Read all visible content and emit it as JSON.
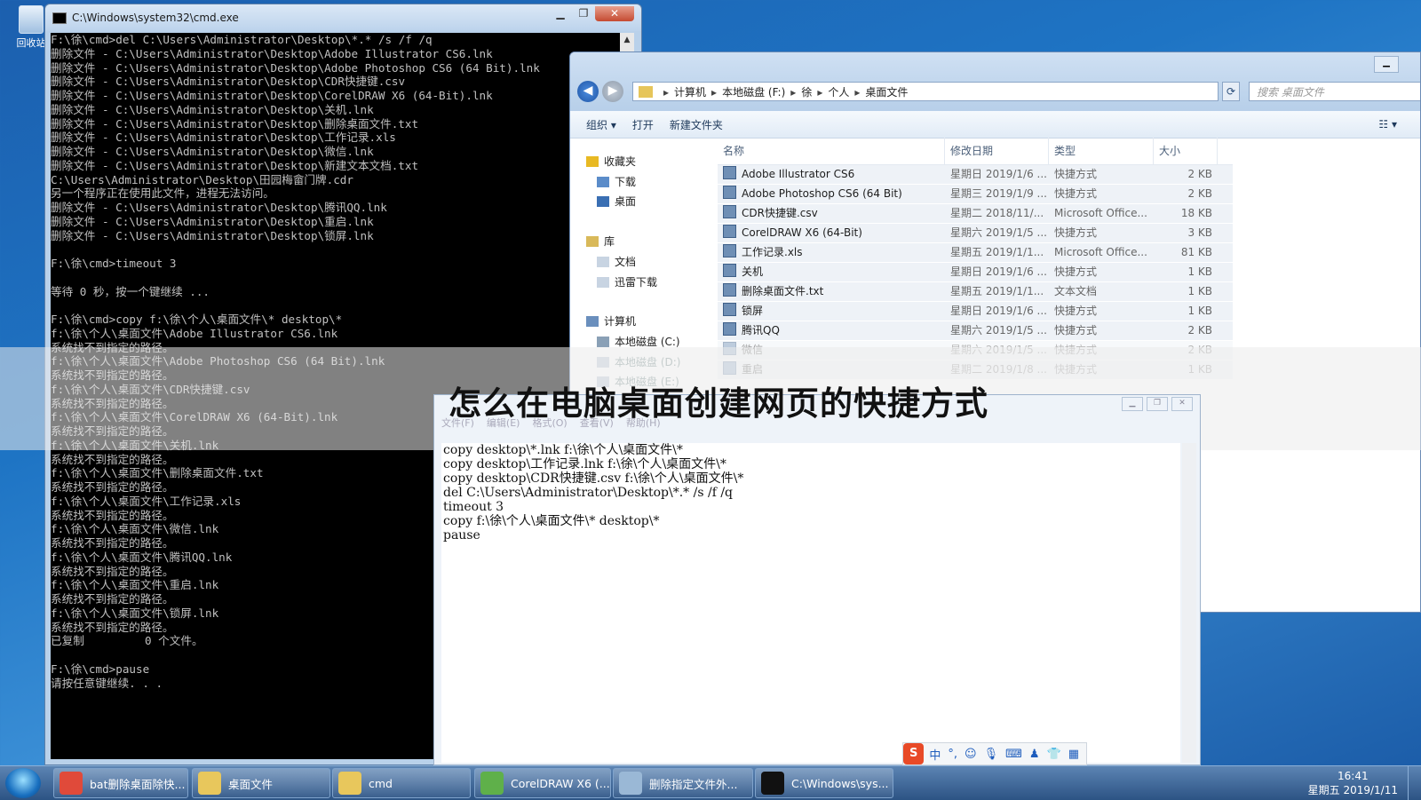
{
  "desktop": {
    "recycle_label": "回收站"
  },
  "cmd": {
    "title": "C:\\Windows\\system32\\cmd.exe",
    "lines": [
      "F:\\徐\\cmd>del C:\\Users\\Administrator\\Desktop\\*.* /s /f /q",
      "删除文件 - C:\\Users\\Administrator\\Desktop\\Adobe Illustrator CS6.lnk",
      "删除文件 - C:\\Users\\Administrator\\Desktop\\Adobe Photoshop CS6 (64 Bit).lnk",
      "删除文件 - C:\\Users\\Administrator\\Desktop\\CDR快捷键.csv",
      "删除文件 - C:\\Users\\Administrator\\Desktop\\CorelDRAW X6 (64-Bit).lnk",
      "删除文件 - C:\\Users\\Administrator\\Desktop\\关机.lnk",
      "删除文件 - C:\\Users\\Administrator\\Desktop\\删除桌面文件.txt",
      "删除文件 - C:\\Users\\Administrator\\Desktop\\工作记录.xls",
      "删除文件 - C:\\Users\\Administrator\\Desktop\\微信.lnk",
      "删除文件 - C:\\Users\\Administrator\\Desktop\\新建文本文档.txt",
      "C:\\Users\\Administrator\\Desktop\\田园梅畲门牌.cdr",
      "另一个程序正在使用此文件，进程无法访问。",
      "删除文件 - C:\\Users\\Administrator\\Desktop\\腾讯QQ.lnk",
      "删除文件 - C:\\Users\\Administrator\\Desktop\\重启.lnk",
      "删除文件 - C:\\Users\\Administrator\\Desktop\\锁屏.lnk",
      "",
      "F:\\徐\\cmd>timeout 3",
      "",
      "等待 0 秒，按一个键继续 ...",
      "",
      "F:\\徐\\cmd>copy f:\\徐\\个人\\桌面文件\\* desktop\\*",
      "f:\\徐\\个人\\桌面文件\\Adobe Illustrator CS6.lnk",
      "系统找不到指定的路径。",
      "f:\\徐\\个人\\桌面文件\\Adobe Photoshop CS6 (64 Bit).lnk",
      "系统找不到指定的路径。",
      "f:\\徐\\个人\\桌面文件\\CDR快捷键.csv",
      "系统找不到指定的路径。",
      "f:\\徐\\个人\\桌面文件\\CorelDRAW X6 (64-Bit).lnk",
      "系统找不到指定的路径。",
      "f:\\徐\\个人\\桌面文件\\关机.lnk",
      "系统找不到指定的路径。",
      "f:\\徐\\个人\\桌面文件\\删除桌面文件.txt",
      "系统找不到指定的路径。",
      "f:\\徐\\个人\\桌面文件\\工作记录.xls",
      "系统找不到指定的路径。",
      "f:\\徐\\个人\\桌面文件\\微信.lnk",
      "系统找不到指定的路径。",
      "f:\\徐\\个人\\桌面文件\\腾讯QQ.lnk",
      "系统找不到指定的路径。",
      "f:\\徐\\个人\\桌面文件\\重启.lnk",
      "系统找不到指定的路径。",
      "f:\\徐\\个人\\桌面文件\\锁屏.lnk",
      "系统找不到指定的路径。",
      "已复制         0 个文件。",
      "",
      "F:\\徐\\cmd>pause",
      "请按任意键继续. . ."
    ]
  },
  "explorer": {
    "breadcrumbs": [
      "计算机",
      "本地磁盘 (F:)",
      "徐",
      "个人",
      "桌面文件"
    ],
    "search_placeholder": "搜索 桌面文件",
    "toolbar": {
      "organize": "组织 ▾",
      "open": "打开",
      "new_folder": "新建文件夹"
    },
    "nav": [
      {
        "label": "收藏夹",
        "color": "#e8b923"
      },
      {
        "label": "下载",
        "color": "#5b8cc9"
      },
      {
        "label": "桌面",
        "color": "#3a6fb3"
      },
      {
        "label": "库",
        "color": "#d9b95a"
      },
      {
        "label": "文档",
        "color": "#c8d4e2"
      },
      {
        "label": "迅雷下载",
        "color": "#c8d4e2"
      },
      {
        "label": "计算机",
        "color": "#6a8fbd"
      },
      {
        "label": "本地磁盘 (C:)",
        "color": "#8aa0b6"
      },
      {
        "label": "本地磁盘 (D:)",
        "color": "#cfd8e2"
      },
      {
        "label": "本地磁盘 (E:)",
        "color": "#cfd8e2"
      }
    ],
    "columns": [
      "名称",
      "修改日期",
      "类型",
      "大小"
    ],
    "files": [
      {
        "name": "Adobe Illustrator CS6",
        "date": "星期日 2019/1/6 ...",
        "type": "快捷方式",
        "size": "2 KB"
      },
      {
        "name": "Adobe Photoshop CS6 (64 Bit)",
        "date": "星期三 2019/1/9 ...",
        "type": "快捷方式",
        "size": "2 KB"
      },
      {
        "name": "CDR快捷键.csv",
        "date": "星期二 2018/11/...",
        "type": "Microsoft Office...",
        "size": "18 KB"
      },
      {
        "name": "CorelDRAW X6 (64-Bit)",
        "date": "星期六 2019/1/5 ...",
        "type": "快捷方式",
        "size": "3 KB"
      },
      {
        "name": "工作记录.xls",
        "date": "星期五 2019/1/1...",
        "type": "Microsoft Office...",
        "size": "81 KB"
      },
      {
        "name": "关机",
        "date": "星期日 2019/1/6 ...",
        "type": "快捷方式",
        "size": "1 KB"
      },
      {
        "name": "删除桌面文件.txt",
        "date": "星期五 2019/1/1...",
        "type": "文本文档",
        "size": "1 KB"
      },
      {
        "name": "锁屏",
        "date": "星期日 2019/1/6 ...",
        "type": "快捷方式",
        "size": "1 KB"
      },
      {
        "name": "腾讯QQ",
        "date": "星期六 2019/1/5 ...",
        "type": "快捷方式",
        "size": "2 KB"
      },
      {
        "name": "微信",
        "date": "星期六 2019/1/5 ...",
        "type": "快捷方式",
        "size": "2 KB"
      },
      {
        "name": "重启",
        "date": "星期二 2019/1/8 ...",
        "type": "快捷方式",
        "size": "1 KB"
      }
    ]
  },
  "headline": "怎么在电脑桌面创建网页的快捷方式",
  "notepad": {
    "menu": [
      "文件(F)",
      "编辑(E)",
      "格式(O)",
      "查看(V)",
      "帮助(H)"
    ],
    "text": "copy desktop\\*.lnk f:\\徐\\个人\\桌面文件\\*\ncopy desktop\\工作记录.lnk f:\\徐\\个人\\桌面文件\\*\ncopy desktop\\CDR快捷键.csv f:\\徐\\个人\\桌面文件\\*\ndel C:\\Users\\Administrator\\Desktop\\*.* /s /f /q\ntimeout 3\ncopy f:\\徐\\个人\\桌面文件\\* desktop\\*\npause"
  },
  "ime": {
    "logo": "S",
    "mode": "中",
    "punct": "°,"
  },
  "taskbar": {
    "items": [
      {
        "label": "bat删除桌面除快...",
        "color": "#e04a3a"
      },
      {
        "label": "桌面文件",
        "color": "#e8c75c"
      },
      {
        "label": "cmd",
        "color": "#e8c75c"
      },
      {
        "label": "CorelDRAW X6 (...",
        "color": "#5fb04a"
      },
      {
        "label": "删除指定文件外...",
        "color": "#9ab8d6"
      },
      {
        "label": "C:\\Windows\\sys...",
        "color": "#111111"
      }
    ],
    "time": "16:41",
    "date": "星期五 2019/1/11"
  }
}
